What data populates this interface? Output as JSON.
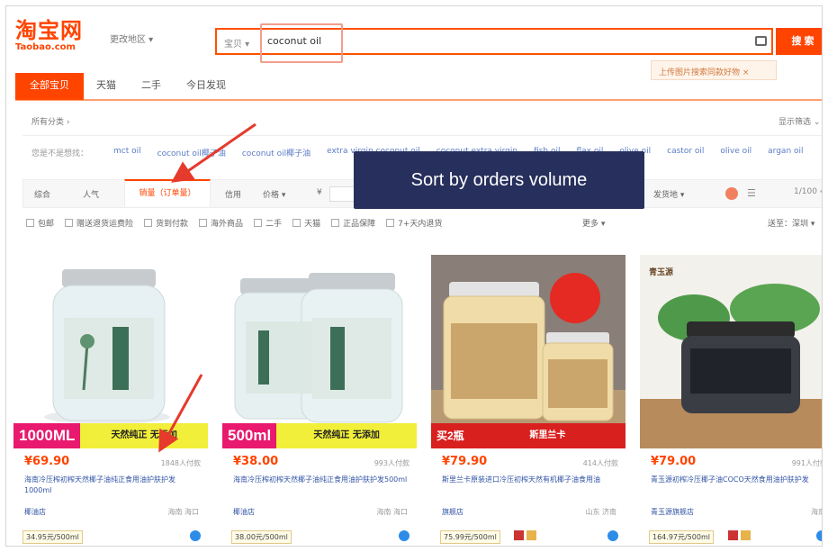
{
  "header": {
    "logo_cn": "淘宝网",
    "logo_en": "Taobao.com",
    "region": "更改地区 ▾",
    "search_scope": "宝贝 ▾",
    "search_query": "coconut oil",
    "search_button": "搜 索",
    "upload_hint": "上传图片搜索同款好物 ×"
  },
  "main_tabs": [
    "全部宝贝",
    "天猫",
    "二手",
    "今日发现"
  ],
  "filters": {
    "all_categories": "所有分类 ›",
    "show_filter": "显示筛选 ⌄",
    "related_label": "您是不是想找：",
    "related_items": [
      "mct oil",
      "coconut oil椰子油",
      "coconut oil椰子油",
      "extra virgin coconut oil",
      "coconut extra virgin",
      "fish oil",
      "flax oil",
      "olive oil",
      "castor oil",
      "olive oil",
      "argan oil"
    ]
  },
  "sort_bar": {
    "items": [
      "综合",
      "人气"
    ],
    "active": "销量（订单量）",
    "after": [
      "信用",
      "价格 ▾"
    ],
    "currency": "¥",
    "ship_from": "发货地 ▾",
    "pager": "1/100 ‹ ›"
  },
  "checkboxes": [
    "包邮",
    "赠送退货运费险",
    "货到付款",
    "海外商品",
    "二手",
    "天猫",
    "正品保障",
    "7+天内退货"
  ],
  "more_link": "更多 ▾",
  "ship_to": "送至：深圳 ▾",
  "tooltip": "Sort by orders volume",
  "products": [
    {
      "price": "¥69.90",
      "sales": "1848人付款",
      "title": "海南冷压榨初榨天然椰子油纯正食用油护肤护发1000ml",
      "shop": "椰油店",
      "location": "海南 海口",
      "unit_price": "34.95元/500ml",
      "promo_left": "1000ML",
      "promo_right": "天然纯正 无添加"
    },
    {
      "price": "¥38.00",
      "sales": "993人付款",
      "title": "海南冷压榨初榨天然椰子油纯正食用油护肤护发500ml",
      "shop": "椰油店",
      "location": "海南 海口",
      "unit_price": "38.00元/500ml",
      "promo_left": "500ml",
      "promo_right": "天然纯正 无添加"
    },
    {
      "price": "¥79.90",
      "sales": "414人付款",
      "title": "斯里兰卡原装进口冷压初榨天然有机椰子油食用油",
      "shop": "旗舰店",
      "location": "山东 济南",
      "unit_price": "75.99元/500ml",
      "promo_left": "买2瓶",
      "promo_right": "斯里兰卡"
    },
    {
      "price": "¥79.00",
      "sales": "991人付款",
      "title": "青玉源初榨冷压椰子油COCO天然食用油护肤护发",
      "shop": "青玉源旗舰店",
      "location": "海南",
      "unit_price": "164.97元/500ml",
      "brand": "青玉源"
    }
  ],
  "colors": {
    "taobao_orange": "#ff4400",
    "tooltip_bg": "#272f5c",
    "link_blue": "#3355a5"
  }
}
